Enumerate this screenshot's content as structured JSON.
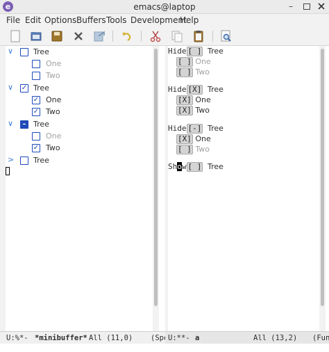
{
  "window": {
    "title": "emacs@laptop",
    "app_icon": "emacs-icon",
    "controls": {
      "minimize": "–"
    }
  },
  "menubar": [
    "File",
    "Edit",
    "Options",
    "Buffers",
    "Tools",
    "Development",
    "Help"
  ],
  "toolbar": {
    "buttons": [
      "new-file-icon",
      "open-folder-icon",
      "save-icon",
      "close-x-icon",
      "save-as-icon",
      "undo-icon",
      "cut-icon",
      "copy-icon",
      "paste-icon",
      "search-icon"
    ]
  },
  "left_tree": {
    "groups": [
      {
        "label": "Tree",
        "state": "unchecked",
        "expanded": true,
        "children": [
          {
            "label": "One",
            "state": "unchecked",
            "dim": true
          },
          {
            "label": "Two",
            "state": "unchecked",
            "dim": true
          }
        ]
      },
      {
        "label": "Tree",
        "state": "checked",
        "expanded": true,
        "children": [
          {
            "label": "One",
            "state": "checked",
            "dim": false
          },
          {
            "label": "Two",
            "state": "checked",
            "dim": false
          }
        ]
      },
      {
        "label": "Tree",
        "state": "mixed",
        "expanded": true,
        "children": [
          {
            "label": "One",
            "state": "unchecked",
            "dim": true
          },
          {
            "label": "Two",
            "state": "checked",
            "dim": false
          }
        ]
      },
      {
        "label": "Tree",
        "state": "unchecked",
        "expanded": false,
        "children": []
      }
    ],
    "check_mark": "✓",
    "mixed_mark": "–"
  },
  "right_text": {
    "groups": [
      {
        "action": "Hide",
        "box": "[ ]",
        "label": "Tree",
        "children": [
          {
            "box": "[ ]",
            "label": "One",
            "dim": true
          },
          {
            "box": "[ ]",
            "label": "Two",
            "dim": true
          }
        ]
      },
      {
        "action": "Hide",
        "box": "[X]",
        "label": "Tree",
        "children": [
          {
            "box": "[X]",
            "label": "One",
            "dim": false
          },
          {
            "box": "[X]",
            "label": "Two",
            "dim": false
          }
        ]
      },
      {
        "action": "Hide",
        "box": "[-]",
        "label": "Tree",
        "children": [
          {
            "box": "[X]",
            "label": "One",
            "dim": false
          },
          {
            "box": "[ ]",
            "label": "Two",
            "dim": true
          }
        ]
      }
    ],
    "last": {
      "action_pre": "Sh",
      "action_cursor": "o",
      "action_post": "w",
      "box": "[ ]",
      "label": "Tree"
    }
  },
  "left_modeline": {
    "status": "U:%*-",
    "buffer": "*minibuffer*",
    "position": "All (11,0)",
    "mode": "(Spe"
  },
  "right_modeline": {
    "status": "U:**-",
    "buffer": "a",
    "position": "All (13,2)",
    "mode": "(Fun"
  }
}
